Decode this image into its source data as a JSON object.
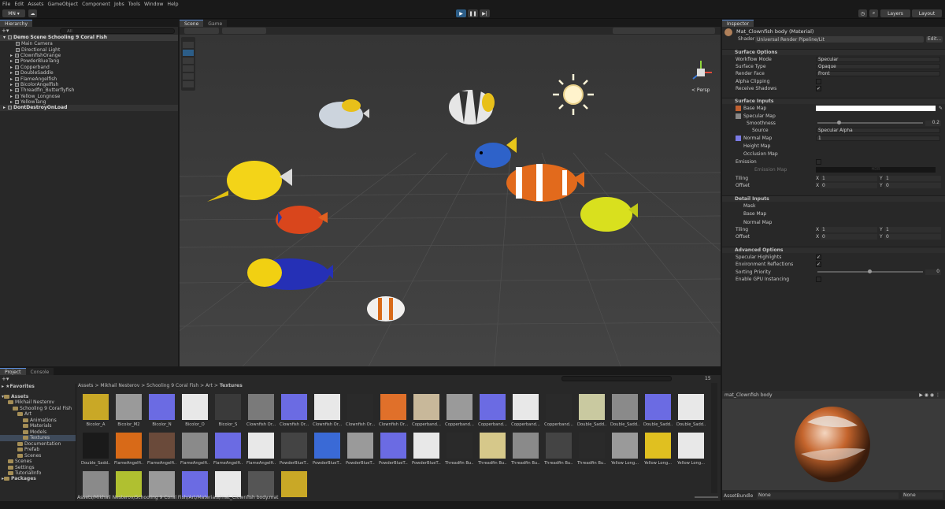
{
  "menu": [
    "File",
    "Edit",
    "Assets",
    "GameObject",
    "Component",
    "Jobs",
    "Tools",
    "Window",
    "Help"
  ],
  "toolbar": {
    "account": "MN ▾",
    "play": "▶",
    "pause": "❚❚",
    "step": "▶|",
    "layers": "Layers",
    "layout": "Layout"
  },
  "hierarchy": {
    "tab": "Hierarchy",
    "search_placeholder": "All",
    "scene_name": "Demo Scene Schooling 9 Coral Fish",
    "items": [
      "Main Camera",
      "Directional Light",
      "ClownfishOrange",
      "PowderBlueTang",
      "Copperband",
      "DoubleSaddle",
      "FlameAngelfish",
      "BicolorAngelfish",
      "Threadfin_Butterflyfish",
      "Yellow_Longnose",
      "YellowTang"
    ],
    "ddol": "DontDestroyOnLoad"
  },
  "scene": {
    "tabs": [
      "Scene",
      "Game"
    ],
    "gizmo_label": "< Persp"
  },
  "inspector": {
    "tab": "Inspector",
    "title": "Mat_Clownfish body (Material)",
    "shader_label": "Shader",
    "shader_value": "Universal Render Pipeline/Lit",
    "edit": "Edit...",
    "surface_options": "Surface Options",
    "workflow_mode": "Workflow Mode",
    "workflow_value": "Specular",
    "surface_type": "Surface Type",
    "surface_value": "Opaque",
    "render_face": "Render Face",
    "render_value": "Front",
    "alpha_clipping": "Alpha Clipping",
    "receive_shadows": "Receive Shadows",
    "surface_inputs": "Surface Inputs",
    "base_map": "Base Map",
    "specular_map": "Specular Map",
    "smoothness": "Smoothness",
    "smoothness_value": "0.2",
    "smoothness_fill": 0.2,
    "source": "Source",
    "source_value": "Specular Alpha",
    "normal_map": "Normal Map",
    "normal_value": "1",
    "height_map": "Height Map",
    "occlusion_map": "Occlusion Map",
    "emission": "Emission",
    "emission_map": "Emission Map",
    "hdr": "HDR",
    "tiling": "Tiling",
    "offset": "Offset",
    "tiling_x": "1",
    "tiling_y": "1",
    "offset_x": "0",
    "offset_y": "0",
    "detail_inputs": "Detail Inputs",
    "mask": "Mask",
    "detail_base": "Base Map",
    "detail_normal": "Normal Map",
    "d_tiling_x": "1",
    "d_tiling_y": "1",
    "d_offset_x": "0",
    "d_offset_y": "0",
    "advanced": "Advanced Options",
    "specular_highlights": "Specular Highlights",
    "env_reflections": "Environment Reflections",
    "sorting_priority": "Sorting Priority",
    "sorting_value": "0",
    "gpu_instancing": "Enable GPU Instancing",
    "x_label": "X",
    "y_label": "Y",
    "preview_title": "mat_Clownfish body",
    "assetbundle_label": "AssetBundle",
    "assetbundle_value": "None",
    "assetbundle_variant": "None"
  },
  "project": {
    "tabs": [
      "Project",
      "Console"
    ],
    "favorites": "Favorites",
    "assets": "Assets",
    "packages": "Packages",
    "tree": [
      "Mikhail Nesterov",
      "Schooling 9 Coral Fish",
      "Art",
      "Animations",
      "Materials",
      "Models",
      "Textures",
      "Documentation",
      "Prefab",
      "Scenes",
      "Scenes",
      "Settings",
      "TutorialInfo"
    ],
    "breadcrumb": [
      "Assets",
      "Mikhail Nesterov",
      "Schooling 9 Coral Fish",
      "Art",
      "Textures"
    ],
    "thumbs": [
      "Bicolor_A",
      "Bicolor_M2",
      "Bicolor_N",
      "Bicolor_O",
      "Bicolor_S",
      "Clownfish Or...",
      "Clownfish Or...",
      "Clownfish Or...",
      "Clownfish Or...",
      "Clownfish Or...",
      "Copperband...",
      "Copperband...",
      "Copperband...",
      "Copperband...",
      "Copperband...",
      "Double_Sadd...",
      "Double_Sadd...",
      "Double_Sadd...",
      "Double_Sadd...",
      "Double_Sadd...",
      "FlameAngelfi...",
      "FlameAngelfi...",
      "FlameAngelfi...",
      "FlameAngelfi...",
      "FlameAngelfi...",
      "PowderBlueT...",
      "PowderBlueT...",
      "PowderBlueT...",
      "PowderBlueT...",
      "PowderBlueT...",
      "Threadfin Bu...",
      "Threadfin Bu...",
      "Threadfin Bu...",
      "Threadfin Bu...",
      "Threadfin Bu...",
      "Yellow Long...",
      "Yellow Long...",
      "Yellow Long...",
      "",
      "",
      "",
      "",
      "",
      "",
      ""
    ],
    "path": "Assets/Mikhail Nesterov/Schooling 9 Coral Fish/Art/Materials/mat_Clownfish body.mat",
    "count": "15"
  },
  "colors": {
    "accent": "#3a79c4",
    "bg": "#282828",
    "scene_bg": "#3b3b3b"
  }
}
